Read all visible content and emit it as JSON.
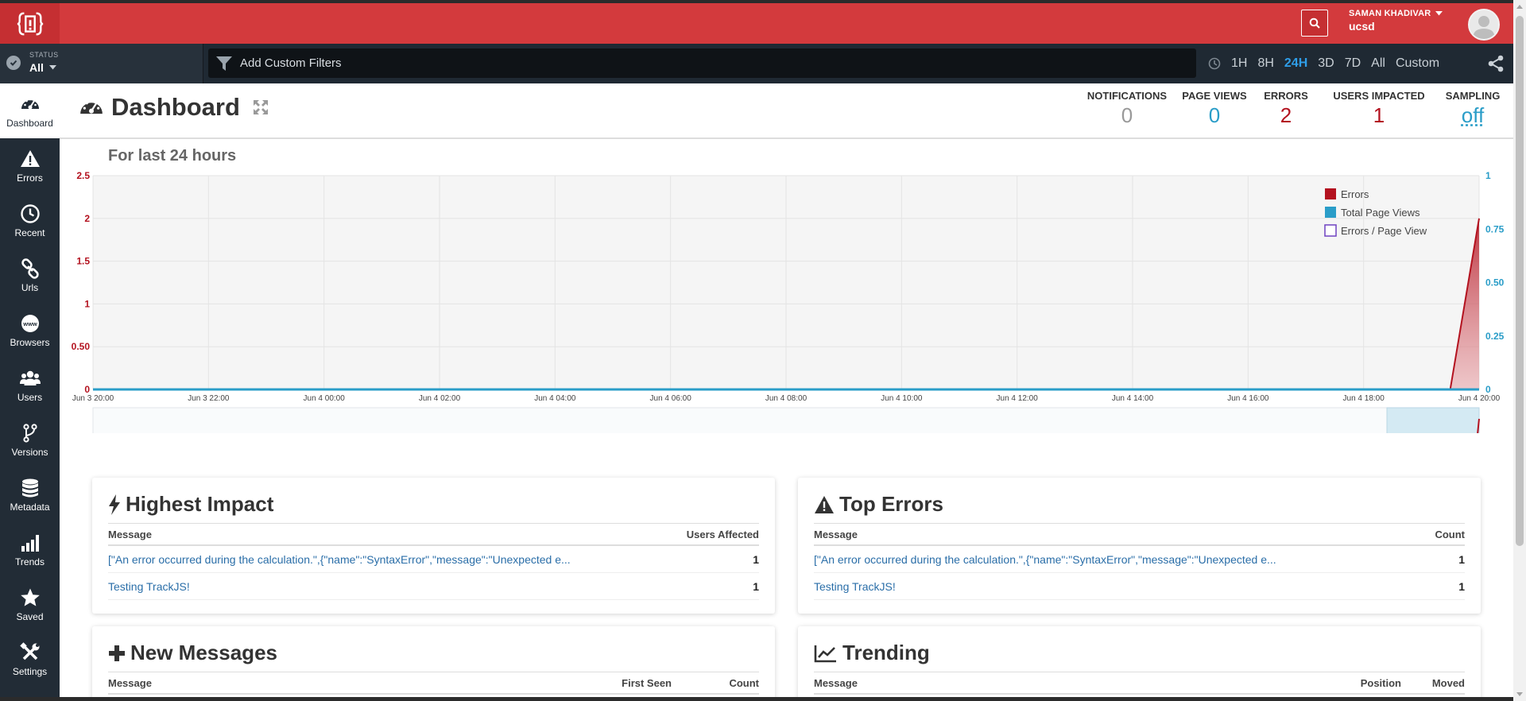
{
  "header": {
    "user_name": "SAMAN KHADIVAR",
    "user_org": "ucsd"
  },
  "filterbar": {
    "status_label": "STATUS",
    "status_value": "All",
    "filter_placeholder": "Add Custom Filters",
    "time_ranges": [
      "1H",
      "8H",
      "24H",
      "3D",
      "7D",
      "All",
      "Custom"
    ],
    "active_range": "24H"
  },
  "sidebar": {
    "items": [
      {
        "label": "Dashboard",
        "icon": "dashboard-icon",
        "active": true
      },
      {
        "label": "Errors",
        "icon": "warning-icon"
      },
      {
        "label": "Recent",
        "icon": "clock-icon"
      },
      {
        "label": "Urls",
        "icon": "link-icon"
      },
      {
        "label": "Browsers",
        "icon": "www-icon"
      },
      {
        "label": "Users",
        "icon": "users-icon"
      },
      {
        "label": "Versions",
        "icon": "branch-icon"
      },
      {
        "label": "Metadata",
        "icon": "database-icon"
      },
      {
        "label": "Trends",
        "icon": "bar-chart-icon"
      },
      {
        "label": "Saved",
        "icon": "star-icon"
      },
      {
        "label": "Settings",
        "icon": "tools-icon"
      }
    ]
  },
  "page": {
    "title": "Dashboard",
    "subtitle": "For last 24 hours"
  },
  "stats": {
    "notifications": {
      "label": "NOTIFICATIONS",
      "value": "0"
    },
    "page_views": {
      "label": "PAGE VIEWS",
      "value": "0"
    },
    "errors": {
      "label": "ERRORS",
      "value": "2"
    },
    "users_impacted": {
      "label": "USERS IMPACTED",
      "value": "1"
    },
    "sampling": {
      "label": "SAMPLING",
      "value": "off"
    }
  },
  "colors": {
    "brand_red": "#d33a3d",
    "errors": "#b3121f",
    "page_views": "#2a9dc8",
    "errors_per_view": "#6f42c1",
    "gray_value": "#999999"
  },
  "chart_data": {
    "type": "area",
    "title": "For last 24 hours",
    "x": [
      "Jun 3 20:00",
      "Jun 3 22:00",
      "Jun 4 00:00",
      "Jun 4 02:00",
      "Jun 4 04:00",
      "Jun 4 06:00",
      "Jun 4 08:00",
      "Jun 4 10:00",
      "Jun 4 12:00",
      "Jun 4 14:00",
      "Jun 4 16:00",
      "Jun 4 18:00",
      "Jun 4 20:00"
    ],
    "y_left_ticks": [
      "0",
      "0.50",
      "1",
      "1.5",
      "2",
      "2.5"
    ],
    "y_left_lim": [
      0,
      2.5
    ],
    "y_right_ticks": [
      "0",
      "0.25",
      "0.50",
      "0.75",
      "1"
    ],
    "y_right_lim": [
      0,
      1
    ],
    "series": [
      {
        "name": "Errors",
        "axis": "left",
        "points": [
          [
            "Jun 3 20:00",
            0
          ],
          [
            "Jun 4 19:30",
            0
          ],
          [
            "Jun 4 20:00",
            2
          ]
        ]
      },
      {
        "name": "Total Page Views",
        "axis": "right",
        "points": [
          [
            "Jun 3 20:00",
            0
          ],
          [
            "Jun 4 20:00",
            0
          ]
        ]
      },
      {
        "name": "Errors / Page View",
        "axis": "right",
        "points": []
      }
    ],
    "legend_position": "top-right",
    "grid": true
  },
  "cards": {
    "highest_impact": {
      "title": "Highest Impact",
      "columns": [
        "Message",
        "Users Affected"
      ],
      "rows": [
        {
          "message": "[\"An error occurred during the calculation.\",{\"name\":\"SyntaxError\",\"message\":\"Unexpected e...",
          "value": "1"
        },
        {
          "message": "Testing TrackJS!",
          "value": "1"
        }
      ]
    },
    "top_errors": {
      "title": "Top Errors",
      "columns": [
        "Message",
        "Count"
      ],
      "rows": [
        {
          "message": "[\"An error occurred during the calculation.\",{\"name\":\"SyntaxError\",\"message\":\"Unexpected e...",
          "value": "1"
        },
        {
          "message": "Testing TrackJS!",
          "value": "1"
        }
      ]
    },
    "new_messages": {
      "title": "New Messages",
      "columns": [
        "Message",
        "First Seen",
        "Count"
      ]
    },
    "trending": {
      "title": "Trending",
      "columns": [
        "Message",
        "Position",
        "Moved"
      ]
    }
  }
}
